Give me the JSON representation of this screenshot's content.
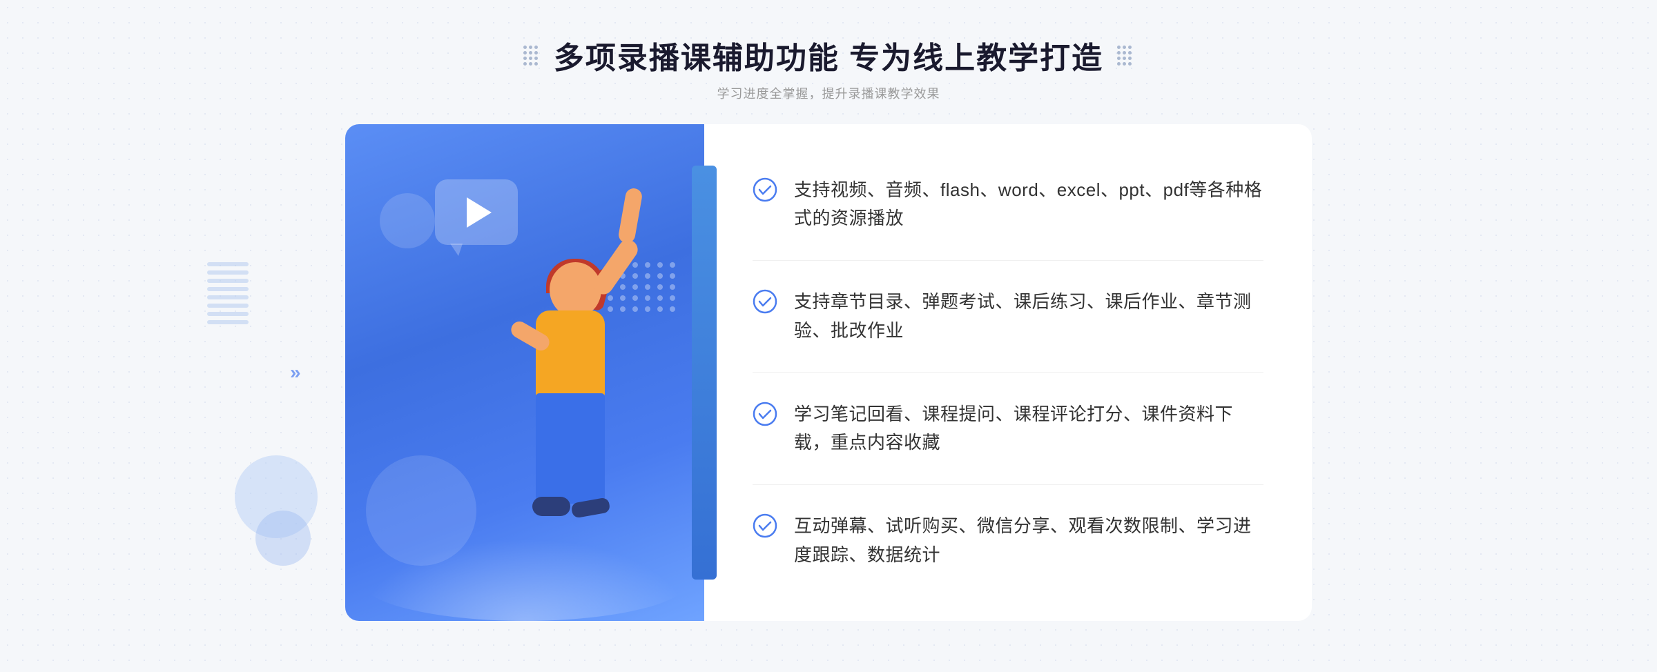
{
  "header": {
    "title": "多项录播课辅助功能 专为线上教学打造",
    "subtitle": "学习进度全掌握，提升录播课教学效果",
    "left_icon": "grid-dots",
    "right_icon": "grid-dots"
  },
  "features": [
    {
      "id": "feature-1",
      "text": "支持视频、音频、flash、word、excel、ppt、pdf等各种格式的资源播放",
      "icon": "check-circle"
    },
    {
      "id": "feature-2",
      "text": "支持章节目录、弹题考试、课后练习、课后作业、章节测验、批改作业",
      "icon": "check-circle"
    },
    {
      "id": "feature-3",
      "text": "学习笔记回看、课程提问、课程评论打分、课件资料下载，重点内容收藏",
      "icon": "check-circle"
    },
    {
      "id": "feature-4",
      "text": "互动弹幕、试听购买、微信分享、观看次数限制、学习进度跟踪、数据统计",
      "icon": "check-circle"
    }
  ],
  "decoration": {
    "chevron_left": "«",
    "play_aria": "play-button"
  }
}
